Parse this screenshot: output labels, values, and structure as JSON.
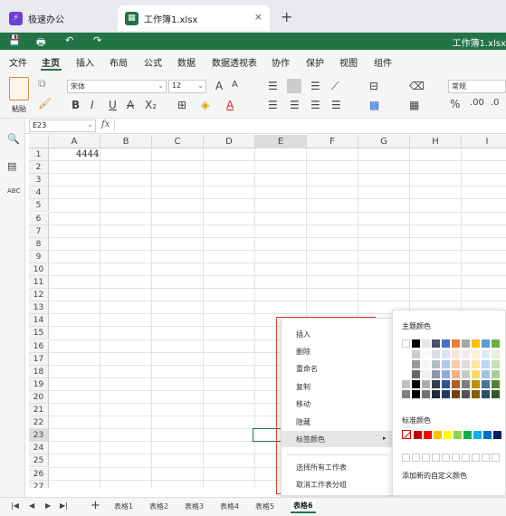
{
  "tabs": {
    "app_tab": "极速办公",
    "file_tab": "工作簿1.xlsx",
    "close": "×",
    "new": "+"
  },
  "workbook_title": "工作簿1.xlsx",
  "menu": [
    "文件",
    "主页",
    "插入",
    "布局",
    "公式",
    "数据",
    "数据透视表",
    "协作",
    "保护",
    "视图",
    "组件"
  ],
  "ribbon": {
    "paste_label": "粘贴",
    "font_name": "宋体",
    "font_size": "12",
    "number_format": "常规",
    "bold": "B",
    "italic": "I",
    "underline": "U",
    "strike": "A",
    "font_grow": "A",
    "font_shrink": "A",
    "percent": "%"
  },
  "formula": {
    "cell_ref": "E23",
    "fx": "fx"
  },
  "columns": [
    "A",
    "B",
    "C",
    "D",
    "E",
    "F",
    "G",
    "H",
    "I"
  ],
  "rows": [
    "1",
    "2",
    "3",
    "4",
    "5",
    "6",
    "7",
    "8",
    "9",
    "10",
    "11",
    "12",
    "13",
    "14",
    "15",
    "16",
    "17",
    "18",
    "19",
    "20",
    "21",
    "22",
    "23",
    "24",
    "25",
    "26",
    "27"
  ],
  "cells": {
    "A1": "4444"
  },
  "context_menu": [
    "插入",
    "删除",
    "重命名",
    "复制",
    "移动",
    "隐藏",
    "标签颜色",
    "选择所有工作表",
    "取消工作表分组"
  ],
  "color_panel": {
    "theme_title": "主题颜色",
    "standard_title": "标准颜色",
    "add_custom": "添加新的自定义颜色",
    "theme_row": [
      "#ffffff",
      "#000000",
      "#e7e6e6",
      "#44546a",
      "#4472c4",
      "#ed7d31",
      "#a5a5a5",
      "#ffc000",
      "#5b9bd5",
      "#70ad47"
    ],
    "standard_row": [
      "#c00000",
      "#ff0000",
      "#ffc000",
      "#ffff00",
      "#92d050",
      "#00b050",
      "#00b0f0",
      "#0070c0",
      "#002060"
    ]
  },
  "sheets": [
    "表格1",
    "表格2",
    "表格3",
    "表格4",
    "表格5",
    "表格6"
  ],
  "active_sheet": "表格6",
  "sheet_add": "+"
}
